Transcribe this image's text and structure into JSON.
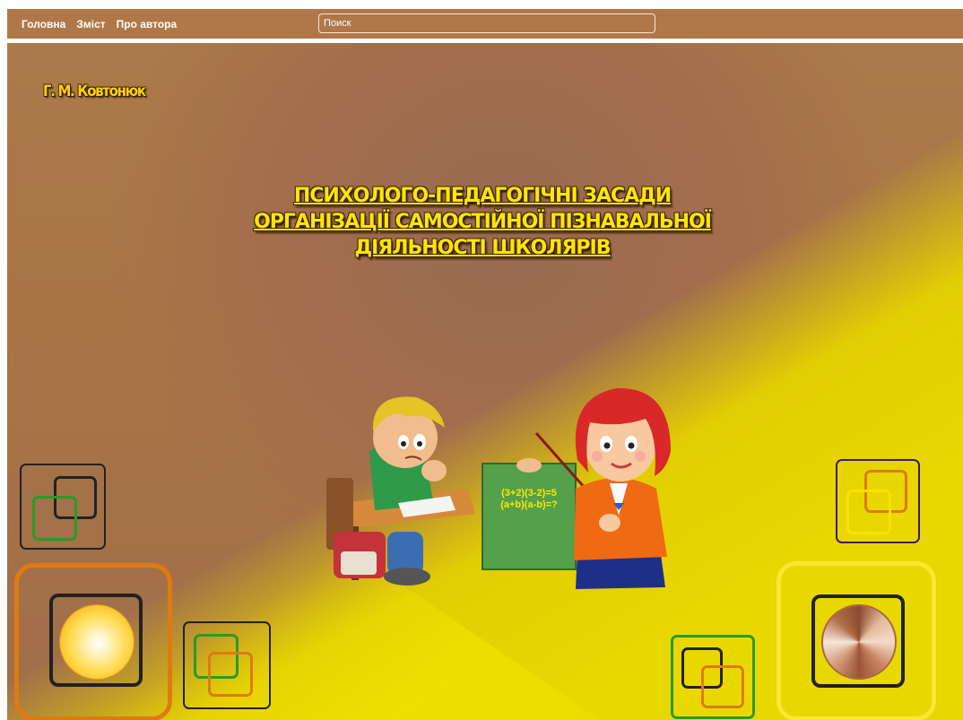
{
  "nav": {
    "home": "Головна",
    "contents": "Зміст",
    "about": "Про автора"
  },
  "search": {
    "placeholder": "Поиск"
  },
  "author": "Г. М. Ковтонюк",
  "title": "ПСИХОЛОГО-ПЕДАГОГІЧНІ ЗАСАДИ\nОРГАНІЗАЦІЇ САМОСТІЙНОЇ ПІЗНАВАЛЬНОЇ\nДІЯЛЬНОСТІ ШКОЛЯРІВ",
  "board": {
    "line1": "(3+2)(3-2)=5",
    "line2": "(a+b)(a-b)=?"
  },
  "colors": {
    "bar": "#b07848",
    "title": "#ffe600",
    "author": "#ffd200",
    "frame_left": "#e07a10",
    "frame_right": "#ffe433"
  },
  "icons": [
    "back-nav-icon",
    "forward-nav-icon",
    "decorative-squares-icon"
  ]
}
